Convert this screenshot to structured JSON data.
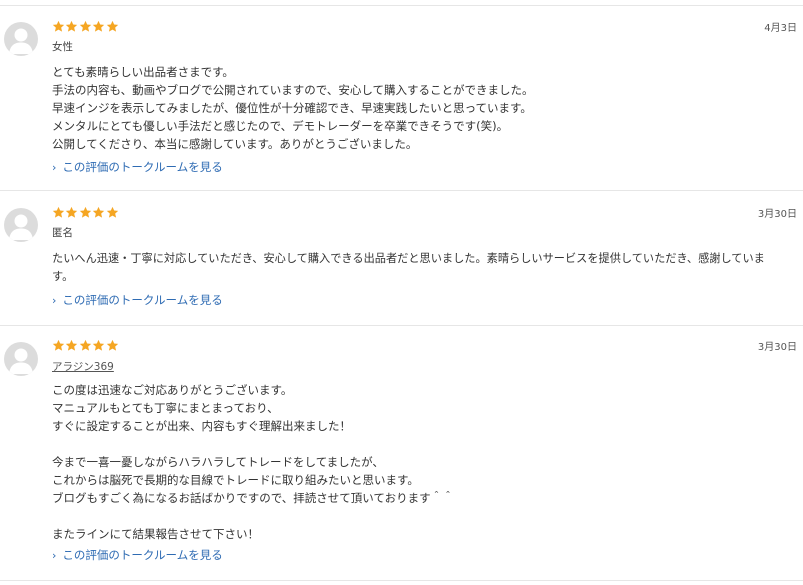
{
  "accent": "#f5a623",
  "link_color": "#2e6bb3",
  "reviews": [
    {
      "stars": 5,
      "user": "女性",
      "date": "4月3日",
      "lines": [
        "とても素晴らしい出品者さまです。",
        "手法の内容も、動画やブログで公開されていますので、安心して購入することができました。",
        "早速インジを表示してみましたが、優位性が十分確認でき、早速実践したいと思っています。",
        "メンタルにとても優しい手法だと感じたので、デモトレーダーを卒業できそうです(笑)。",
        "公開してくださり、本当に感謝しています。ありがとうございました。"
      ],
      "talk_link": "この評価のトークルームを見る"
    },
    {
      "stars": 5,
      "user": "匿名",
      "date": "3月30日",
      "lines": [
        "たいへん迅速・丁寧に対応していただき、安心して購入できる出品者だと思いました。素晴らしいサービスを提供していただき、感謝していま",
        "す。"
      ],
      "talk_link": "この評価のトークルームを見る"
    },
    {
      "stars": 5,
      "user": "アラジン369",
      "date": "3月30日",
      "lines": [
        "この度は迅速なご対応ありがとうございます。",
        "マニュアルもとても丁寧にまとまっており、",
        "すぐに設定することが出来、内容もすぐ理解出来ました！",
        "",
        "今まで一喜一憂しながらハラハラしてトレードをしてましたが、",
        "これからは脳死で長期的な目線でトレードに取り組みたいと思います。",
        "ブログもすごく為になるお話ばかりですので、拝読させて頂いております＾＾",
        "",
        "またラインにて結果報告させて下さい！"
      ],
      "talk_link": "この評価のトークルームを見る"
    }
  ]
}
